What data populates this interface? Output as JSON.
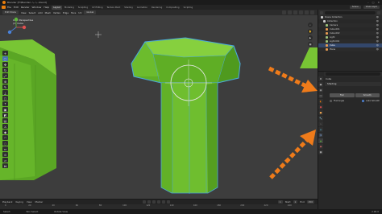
{
  "window": {
    "title": "Blender [F:\\Blender...\\...\\...blend]"
  },
  "menubar": {
    "menus": [
      "File",
      "Edit",
      "Render",
      "Window",
      "Help"
    ],
    "workspaces": [
      "Layout",
      "Modeling",
      "Sculpting",
      "UV Editing",
      "Texture Paint",
      "Shading",
      "Animation",
      "Rendering",
      "Compositing",
      "Scripting"
    ],
    "active_workspace": "Layout",
    "scene": "Scene",
    "view_layer": "View Layer"
  },
  "viewport_header": {
    "mode": "Edit Mode",
    "menus": [
      "View",
      "Select",
      "Add",
      "Mesh",
      "Vertex",
      "Edge",
      "Face",
      "UV"
    ],
    "transform_orientation": "Global"
  },
  "viewport_info": {
    "line1": "User Perspective",
    "line2": "(1) Cube"
  },
  "tools": [
    "cursor",
    "move",
    "rotate",
    "scale",
    "transform",
    "annotate",
    "measure",
    "add-cube",
    "extrude",
    "inset",
    "bevel",
    "loop-cut",
    "knife",
    "poly-build",
    "spin",
    "smooth",
    "edge-slide",
    "shrink",
    "shear",
    "rip"
  ],
  "timeline": {
    "menus": [
      "Playback",
      "Keying",
      "View",
      "Marker"
    ],
    "start_label": "Start",
    "start": "1",
    "end_label": "End",
    "end": "250",
    "current": "1",
    "ticks": [
      "0",
      "20",
      "40",
      "60",
      "80",
      "100",
      "120",
      "140",
      "160",
      "180",
      "200",
      "220",
      "240"
    ]
  },
  "statusbar": {
    "left": "Select",
    "middle": "Box Select",
    "right": "Rotate View",
    "version": "2.90.0"
  },
  "outliner": {
    "rows": [
      {
        "label": "Scene Collection",
        "color": "#cccccc"
      },
      {
        "label": "Collection",
        "color": "#cccccc"
      },
      {
        "label": "Camera",
        "color": "#9ec27a"
      },
      {
        "label": "Cube.001",
        "color": "#e69a50"
      },
      {
        "label": "Cube.002",
        "color": "#e69a50"
      },
      {
        "label": "Light",
        "color": "#9ec27a"
      },
      {
        "label": "Light.001",
        "color": "#9ec27a"
      },
      {
        "label": "Cube",
        "color": "#e69a50",
        "selected": true
      },
      {
        "label": "Plane",
        "color": "#e69a50"
      }
    ]
  },
  "properties": {
    "breadcrumb": "Cube",
    "panel": "Shading",
    "mode_buttons": [
      "Flat",
      "Smooth"
    ],
    "option_left": "Flat Angle",
    "option_right": "Auto Smooth"
  },
  "colors": {
    "mesh_green": "#6bbb2e",
    "selection_blue": "#4772b3",
    "annotation_orange": "#ef7b1a",
    "viewport_bg": "#3d3d3d"
  }
}
